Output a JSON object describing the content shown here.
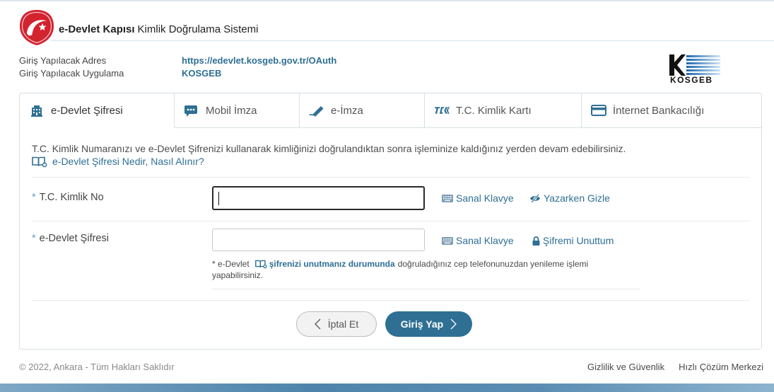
{
  "header": {
    "brand_bold": "e-Devlet Kapısı",
    "brand_rest": "Kimlik Doğrulama Sistemi"
  },
  "info": {
    "address_label": "Giriş Yapılacak Adres",
    "address_value": "https://edevlet.kosgeb.gov.tr/OAuth",
    "application_label": "Giriş Yapılacak Uygulama",
    "application_value": "KOSGEB",
    "partner_logo_text": "KOSGEB"
  },
  "tabs": [
    {
      "label": "e-Devlet Şifresi",
      "icon": "building-icon",
      "active": true
    },
    {
      "label": "Mobil İmza",
      "icon": "mobile-signature-icon",
      "active": false
    },
    {
      "label": "e-İmza",
      "icon": "pen-icon",
      "active": false
    },
    {
      "label": "T.C. Kimlik Kartı",
      "icon": "id-card-icon",
      "active": false
    },
    {
      "label": "İnternet Bankacılığı",
      "icon": "credit-card-icon",
      "active": false
    }
  ],
  "form": {
    "description": "T.C. Kimlik Numaranızı ve e-Devlet Şifrenizi kullanarak kimliğinizi doğrulandıktan sonra işleminize kaldığınız yerden devam edebilirsiniz.",
    "help_link": "e-Devlet Şifresi Nedir, Nasıl Alınır?",
    "required_mark": "*",
    "tc_label": "T.C. Kimlik No",
    "tc_value": "",
    "tc_focused": true,
    "password_label": "e-Devlet Şifresi",
    "password_value": "",
    "virtual_keyboard": "Sanal Klavye",
    "hide_while_typing": "Yazarken Gizle",
    "forgot_password": "Şifremi Unuttum",
    "note_prefix": "* e-Devlet",
    "note_link": "şifrenizi unutmanız durumunda",
    "note_suffix": "doğruladığınız cep telefonunuzdan yenileme işlemi",
    "note_end": "yapabilirsiniz."
  },
  "actions": {
    "cancel": "İptal Et",
    "submit": "Giriş Yap"
  },
  "footer": {
    "copyright": "© 2022, Ankara - Tüm Hakları Saklıdır",
    "privacy": "Gizlilik ve Güvenlik",
    "help_center": "Hızlı Çözüm Merkezi"
  },
  "colors": {
    "link": "#2e6f94",
    "primary_button": "#2f6f94",
    "brand_red": "#d2232f",
    "required_mark": "#5f9fcb",
    "focused_input_border": "#2a2a2a"
  }
}
